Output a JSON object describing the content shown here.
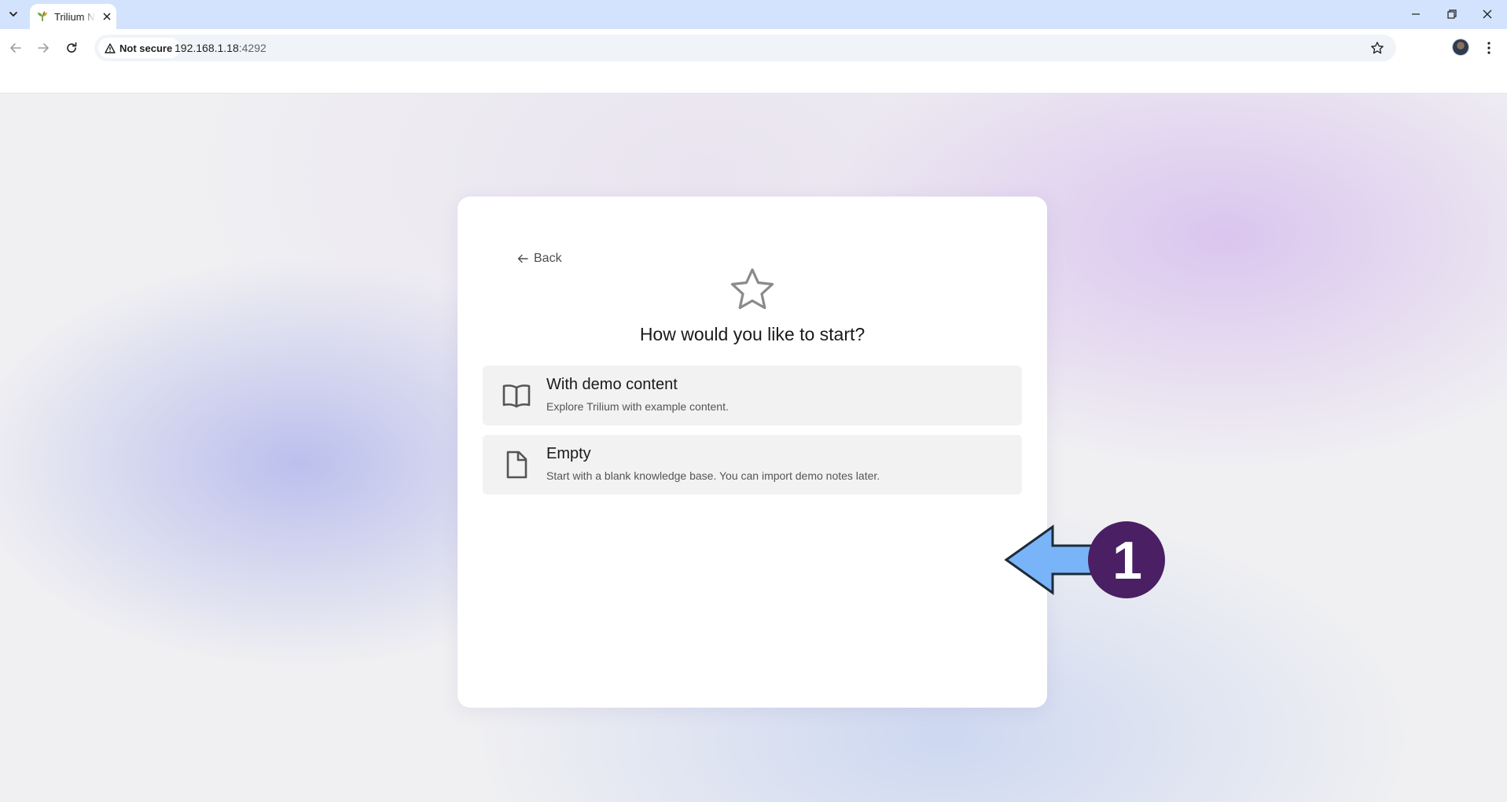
{
  "browser": {
    "tab": {
      "title": "Trilium Notes"
    },
    "address": {
      "security_label": "Not secure",
      "host": "192.168.1.18",
      "port": ":4292"
    }
  },
  "setup": {
    "back_label": "Back",
    "heading": "How would you like to start?",
    "options": [
      {
        "title": "With demo content",
        "description": "Explore Trilium with example content.",
        "icon": "open-book-icon"
      },
      {
        "title": "Empty",
        "description": "Start with a blank knowledge base. You can import demo notes later.",
        "icon": "blank-file-icon"
      }
    ]
  },
  "callout": {
    "number": "1",
    "badge_color": "#4a1f63",
    "arrow_color": "#7ab4f8"
  }
}
